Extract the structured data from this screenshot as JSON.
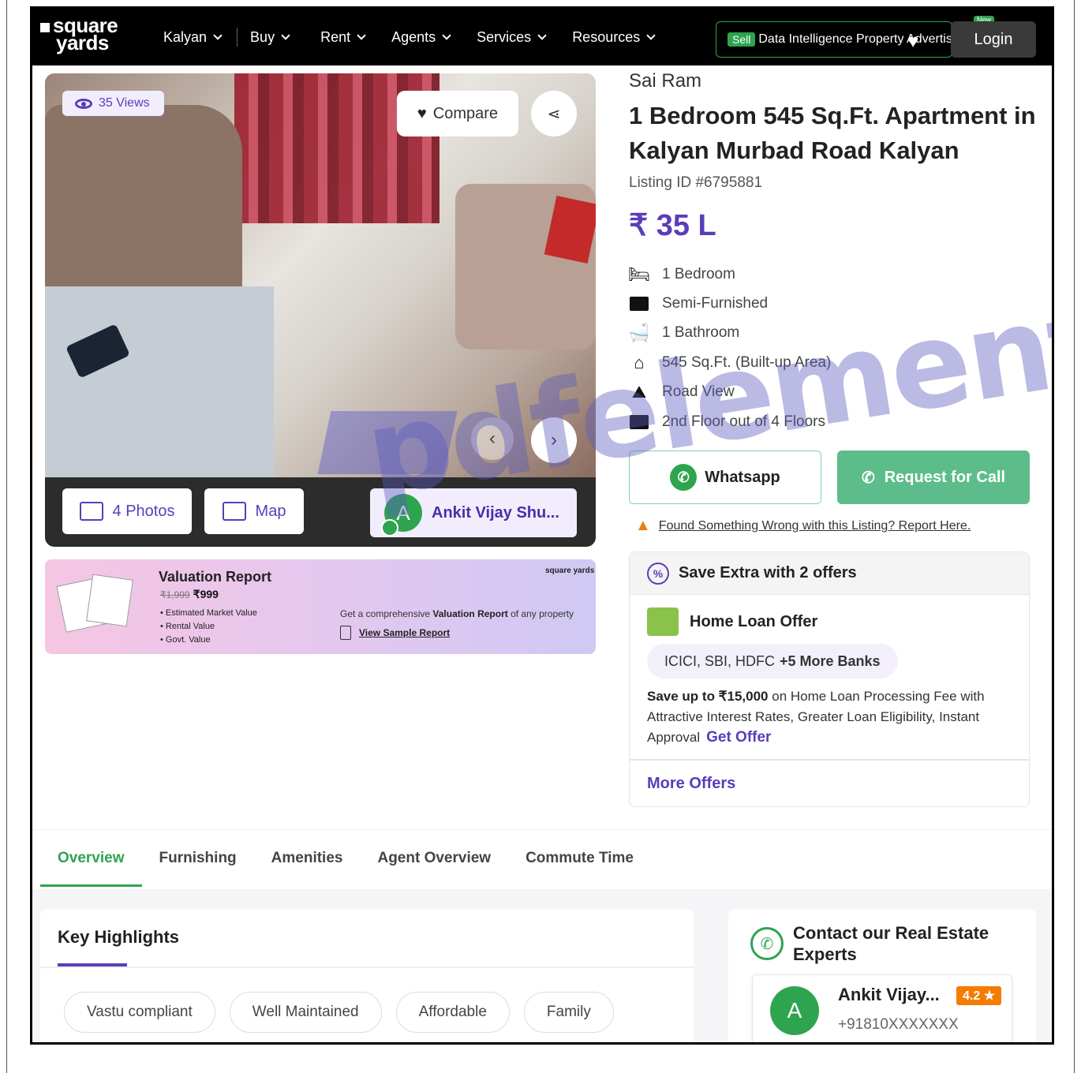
{
  "header": {
    "logo_line1": "square",
    "logo_line2": "yards",
    "nav": [
      {
        "label": "Kalyan"
      },
      {
        "label": "Buy"
      },
      {
        "label": "Rent"
      },
      {
        "label": "Agents"
      },
      {
        "label": "Services"
      },
      {
        "label": "Resources"
      }
    ],
    "overlap_sell": "Sell",
    "overlap_text": "Data Intelligence Property Advertise",
    "new_badge": "New",
    "login_label": "Login"
  },
  "gallery": {
    "views": "35 Views",
    "compare_label": "Compare",
    "photos_label": "4 Photos",
    "map_label": "Map",
    "agent_initial": "A",
    "agent_name": "Ankit Vijay Shu..."
  },
  "valuation": {
    "title": "Valuation Report",
    "old_price": "₹1,999",
    "new_price": "₹999",
    "bullets": [
      "Estimated Market Value",
      "Rental Value",
      "Govt. Value"
    ],
    "logo": "square yards",
    "desc_prefix": "Get a comprehensive",
    "desc_bold": "Valuation Report",
    "desc_suffix": "of any property",
    "link": "View Sample Report"
  },
  "property": {
    "developer": "Sai Ram",
    "title": "1 Bedroom 545 Sq.Ft. Apartment in Kalyan Murbad Road Kalyan",
    "listing_id": "Listing ID #6795881",
    "price": "₹ 35 L",
    "features": [
      {
        "icon": "bed-icon",
        "label": "1 Bedroom"
      },
      {
        "icon": "sofa-icon",
        "label": "Semi-Furnished"
      },
      {
        "icon": "bathtub-icon",
        "label": "1 Bathroom"
      },
      {
        "icon": "home-icon",
        "label": "545 Sq.Ft. (Built-up Area)"
      },
      {
        "icon": "road-view-icon",
        "label": "Road View"
      },
      {
        "icon": "stairs-icon",
        "label": "2nd Floor out of 4 Floors"
      }
    ],
    "whatsapp_label": "Whatsapp",
    "call_label": "Request for Call",
    "report_text": "Found Something Wrong with this Listing? Report Here."
  },
  "offers": {
    "head": "Save Extra with 2 offers",
    "loan_title": "Home Loan Offer",
    "banks": "ICICI, SBI, HDFC",
    "banks_more": "+5 More Banks",
    "desc_bold": "Save up to ₹15,000",
    "desc_rest": "on Home Loan Processing Fee with Attractive Interest Rates, Greater Loan Eligibility, Instant Approval",
    "get_offer": "Get Offer",
    "more_offers": "More Offers"
  },
  "tabs": [
    {
      "label": "Overview",
      "active": true
    },
    {
      "label": "Furnishing"
    },
    {
      "label": "Amenities"
    },
    {
      "label": "Agent Overview"
    },
    {
      "label": "Commute Time"
    }
  ],
  "highlights": {
    "title": "Key Highlights",
    "chips": [
      "Vastu compliant",
      "Well Maintained",
      "Affordable",
      "Family"
    ]
  },
  "contact": {
    "title": "Contact our Real Estate Experts",
    "agent_initial": "A",
    "agent_name": "Ankit Vijay...",
    "rating": "4.2 ★",
    "phone": "+91810XXXXXXX"
  },
  "watermark": "pdfelement",
  "colors": {
    "brand_purple": "#5b3db8",
    "green": "#2ea44f",
    "call_green": "#5dbd8a",
    "rating_orange": "#f57c00"
  }
}
